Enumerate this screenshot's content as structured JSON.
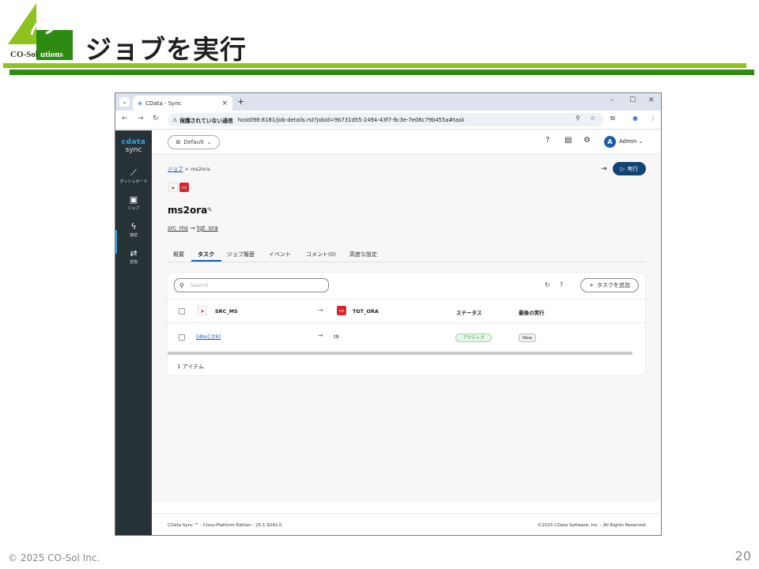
{
  "slide": {
    "title": "ジョブを実行",
    "logo_text": "CO-Solutions",
    "copyright": "© 2025 CO-Sol Inc.",
    "page_number": "20",
    "colors": {
      "green_rule": "#8dc21f",
      "dark_rule": "#2e8b12"
    }
  },
  "browser": {
    "tab_title": "CData - Sync",
    "tab_close": "×",
    "new_tab": "+",
    "url_insecure": "保護されていない通信",
    "url": "host098:8181/job-details.rst?jobid=9b731d55-2494-43f7-9c3e-7e06c79b455a#task",
    "window_controls": [
      "–",
      "☐",
      "✕"
    ]
  },
  "sidebar": {
    "brand_top": "cdata",
    "brand_bottom": "sync",
    "items": [
      {
        "label": "ダッシュボード",
        "icon": "chart-icon"
      },
      {
        "label": "ジョブ",
        "icon": "briefcase-icon"
      },
      {
        "label": "接続",
        "icon": "plug-icon"
      },
      {
        "label": "変換",
        "icon": "swap-icon"
      }
    ],
    "accent": "#37a3e8"
  },
  "topbar": {
    "workspace": "Default",
    "user_initial": "A",
    "user_name": "Admin"
  },
  "job": {
    "breadcrumb_root": "ジョブ",
    "breadcrumb_sep": ">",
    "breadcrumb_current": "ms2ora",
    "name": "ms2ora",
    "source": "src_ms",
    "arrow": "→",
    "destination": "tgt_ora",
    "run_label": "実行"
  },
  "tabs": [
    "概要",
    "タスク",
    "ジョブ履歴",
    "イベント",
    "コメント(0)",
    "高度な設定"
  ],
  "tasks": {
    "search_placeholder": "Search",
    "add_task_label": "タスクを追加",
    "header": {
      "source": "SRC_MS",
      "destination": "TGT_ORA",
      "status": "ステータス",
      "last_run": "最後の実行"
    },
    "rows": [
      {
        "source": "[dbo].[t9]",
        "destination": "t9",
        "status": "アクティブ",
        "last_run": "New"
      }
    ],
    "item_count": "1 アイテム"
  },
  "footer": {
    "left": "CData Sync ™ - Cross-Platform Edition - 25.1.9242.0",
    "right": "©2025 CData Software, Inc. - All Rights Reserved."
  }
}
